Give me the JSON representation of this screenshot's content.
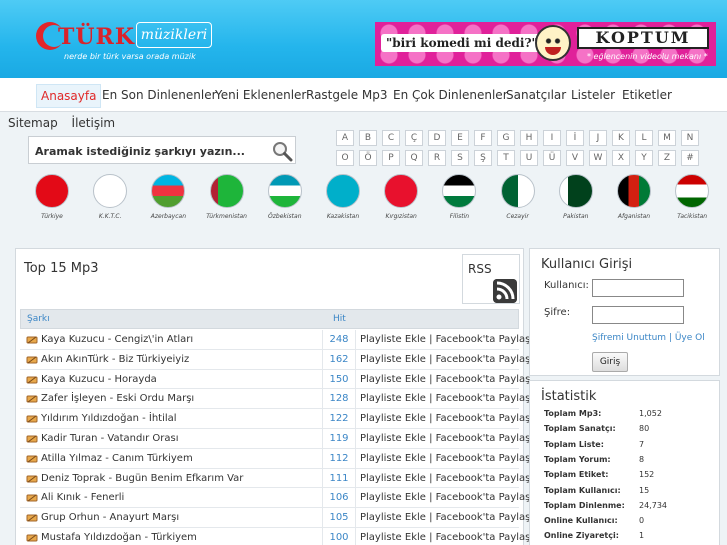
{
  "header": {
    "logo_turk": "TÜRK",
    "logo_muzikleri": "müzikleri",
    "logo_slogan": "nerde bir türk varsa orada müzik",
    "banner": {
      "quote": "\"biri komedi mi dedi?\"",
      "brand": "KOPTUM",
      "sub": "* eğlencenin videolu mekanı *"
    }
  },
  "nav": {
    "items": [
      "Anasayfa",
      "En Son Dinlenenler",
      "Yeni Eklenenler",
      "Rastgele Mp3",
      "En Çok Dinlenenler",
      "Sanatçılar",
      "Listeler",
      "Etiketler"
    ]
  },
  "sublinks": [
    "Sitemap",
    "İletişim"
  ],
  "search": {
    "placeholder": "Aramak istediğiniz şarkıyı yazın..."
  },
  "alphabet": [
    "A",
    "B",
    "C",
    "Ç",
    "D",
    "E",
    "F",
    "G",
    "H",
    "I",
    "İ",
    "J",
    "K",
    "L",
    "M",
    "N",
    "O",
    "Ö",
    "P",
    "Q",
    "R",
    "S",
    "Ş",
    "T",
    "U",
    "Ü",
    "V",
    "W",
    "X",
    "Y",
    "Z",
    "#"
  ],
  "flags": [
    "Türkiye",
    "K.K.T.C.",
    "Azerbaycan",
    "Türkmenistan",
    "Özbekistan",
    "Kazakistan",
    "Kırgızistan",
    "Filistin",
    "Cezayir",
    "Pakistan",
    "Afganistan",
    "Tacikistan"
  ],
  "top15": {
    "title": "Top 15 Mp3",
    "rss_label": "RSS",
    "col_song": "Şarkı",
    "col_hit": "Hit",
    "rows": [
      {
        "song": "Kaya Kuzucu - Cengiz\\'in Atları",
        "hit": "248",
        "acts": "Playliste Ekle | Facebook'ta Paylaş"
      },
      {
        "song": "Akın AkınTürk - Biz Türkiyeiyiz",
        "hit": "162",
        "acts": "Playliste Ekle | Facebook'ta Paylaş"
      },
      {
        "song": "Kaya Kuzucu - Horayda",
        "hit": "150",
        "acts": "Playliste Ekle | Facebook'ta Paylaş"
      },
      {
        "song": "Zafer İşleyen - Eski Ordu Marşı",
        "hit": "128",
        "acts": "Playliste Ekle | Facebook'ta Paylaş"
      },
      {
        "song": "Yıldırım Yıldızdoğan - İhtilal",
        "hit": "122",
        "acts": "Playliste Ekle | Facebook'ta Paylaş"
      },
      {
        "song": "Kadir Turan - Vatandır Orası",
        "hit": "119",
        "acts": "Playliste Ekle | Facebook'ta Paylaş"
      },
      {
        "song": "Atilla Yılmaz - Canım Türkiyem",
        "hit": "112",
        "acts": "Playliste Ekle | Facebook'ta Paylaş"
      },
      {
        "song": "Deniz Toprak - Bugün Benim Efkarım Var",
        "hit": "111",
        "acts": "Playliste Ekle | Facebook'ta Paylaş"
      },
      {
        "song": "Ali Kınık - Fenerli",
        "hit": "106",
        "acts": "Playliste Ekle | Facebook'ta Paylaş"
      },
      {
        "song": "Grup Orhun - Anayurt Marşı",
        "hit": "105",
        "acts": "Playliste Ekle | Facebook'ta Paylaş"
      },
      {
        "song": "Mustafa Yıldızdoğan - Türkiyem",
        "hit": "100",
        "acts": "Playliste Ekle | Facebook'ta Paylaş"
      }
    ]
  },
  "login": {
    "title": "Kullanıcı Girişi",
    "user_label": "Kullanıcı:",
    "pass_label": "Şifre:",
    "links": "Şifremi Unuttum | Üye Ol",
    "button": "Giriş"
  },
  "stats": {
    "title": "İstatistik",
    "rows": [
      {
        "k": "Toplam Mp3:",
        "v": "1,052"
      },
      {
        "k": "Toplam Sanatçı:",
        "v": "80"
      },
      {
        "k": "Toplam Liste:",
        "v": "7"
      },
      {
        "k": "Toplam Yorum:",
        "v": "8"
      },
      {
        "k": "Toplam Etiket:",
        "v": "152"
      },
      {
        "k": "Toplam Kullanıcı:",
        "v": "15"
      },
      {
        "k": "Toplam Dinlenme:",
        "v": "24,734"
      },
      {
        "k": "Online Kullanıcı:",
        "v": "0"
      },
      {
        "k": "Online Ziyaretçi:",
        "v": "1"
      }
    ]
  }
}
